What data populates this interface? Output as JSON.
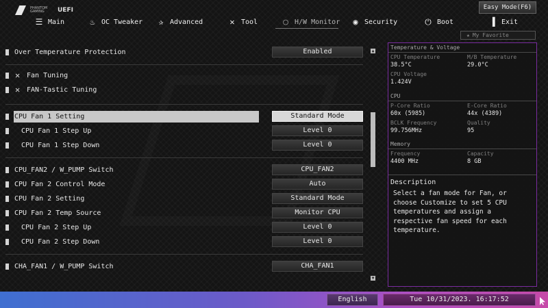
{
  "brand": {
    "logo_text": "PHANTOM GAMING",
    "uefi": "UEFI"
  },
  "easy_mode_label": "Easy Mode(F6)",
  "tabs": [
    {
      "label": "Main",
      "icon": "list-icon"
    },
    {
      "label": "OC Tweaker",
      "icon": "flame-icon"
    },
    {
      "label": "Advanced",
      "icon": "star-icon"
    },
    {
      "label": "Tool",
      "icon": "tools-icon"
    },
    {
      "label": "H/W Monitor",
      "icon": "monitor-circle-icon",
      "active": true
    },
    {
      "label": "Security",
      "icon": "shield-icon"
    },
    {
      "label": "Boot",
      "icon": "power-icon"
    },
    {
      "label": "Exit",
      "icon": "exit-icon"
    }
  ],
  "favorite_label": "My Favorite",
  "settings": [
    {
      "label": "Over Temperature Protection",
      "value": "Enabled"
    },
    {
      "label": "Fan Tuning"
    },
    {
      "label": "FAN-Tastic Tuning"
    },
    {
      "label": "CPU Fan 1 Setting",
      "value": "Standard Mode",
      "selected": true
    },
    {
      "label": "CPU Fan 1 Step Up",
      "value": "Level 0"
    },
    {
      "label": "CPU Fan 1 Step Down",
      "value": "Level 0"
    },
    {
      "label": "CPU_FAN2 / W_PUMP Switch",
      "value": "CPU_FAN2"
    },
    {
      "label": "CPU Fan 2 Control Mode",
      "value": "Auto"
    },
    {
      "label": "CPU Fan 2 Setting",
      "value": "Standard Mode"
    },
    {
      "label": "CPU Fan 2 Temp Source",
      "value": "Monitor CPU"
    },
    {
      "label": "CPU Fan 2 Step Up",
      "value": "Level 0"
    },
    {
      "label": "CPU Fan 2 Step Down",
      "value": "Level 0"
    },
    {
      "label": "CHA_FAN1 / W_PUMP Switch",
      "value": "CHA_FAN1"
    }
  ],
  "panel": {
    "temp_title": "Temperature & Voltage",
    "cpu_temp_label": "CPU Temperature",
    "cpu_temp": "38.5°C",
    "mb_temp_label": "M/B Temperature",
    "mb_temp": "29.0°C",
    "cpu_volt_label": "CPU Voltage",
    "cpu_volt": "1.424V",
    "cpu_title": "CPU",
    "pcore_label": "P-Core Ratio",
    "pcore": "60x (5985)",
    "ecore_label": "E-Core Ratio",
    "ecore": "44x (4389)",
    "bclk_label": "BCLK Frequency",
    "bclk": "99.756MHz",
    "quality_label": "Quality",
    "quality": "95",
    "mem_title": "Memory",
    "freq_label": "Frequency",
    "freq": "4400 MHz",
    "cap_label": "Capacity",
    "cap": "8 GB",
    "desc_title": "Description",
    "desc_text": "Select a fan mode for Fan, or choose Customize to set 5 CPU temperatures and assign a respective fan speed for each temperature."
  },
  "bottom": {
    "language": "English",
    "datetime": "Tue 10/31/2023. 16:17:52"
  },
  "colors": {
    "panel_border": "#7a2ca0",
    "bottom_gradient_start": "#3f6fd0",
    "bottom_gradient_end": "#c64aa8"
  }
}
